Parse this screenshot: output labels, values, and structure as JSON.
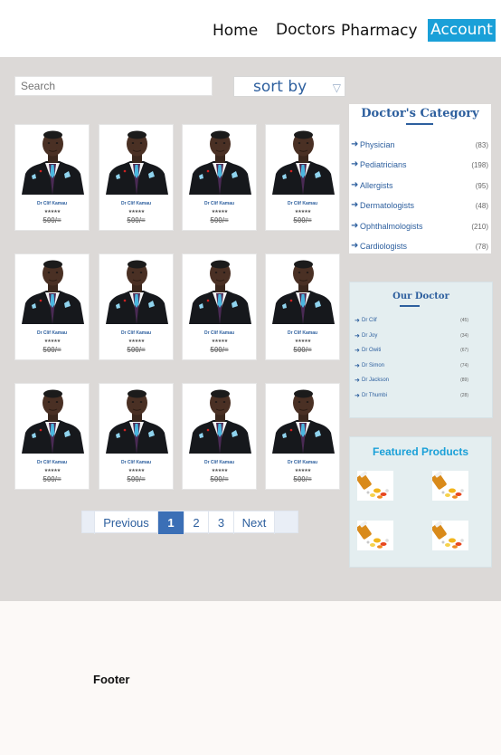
{
  "nav": {
    "home": "Home",
    "doctors": "Doctors",
    "pharmacy": "Pharmacy",
    "account": "Account"
  },
  "toolbar": {
    "search_placeholder": "Search",
    "sort_label": "sort by",
    "sort_icon": "triangle-down-icon"
  },
  "doctor_cards": [
    {
      "name": "Dr Clif Kamau",
      "rating": "★★★★★",
      "price": "500/="
    },
    {
      "name": "Dr Clif Kamau",
      "rating": "★★★★★",
      "price": "500/="
    },
    {
      "name": "Dr Clif Kamau",
      "rating": "★★★★★",
      "price": "500/="
    },
    {
      "name": "Dr Clif Kamau",
      "rating": "★★★★★",
      "price": "500/="
    },
    {
      "name": "Dr Clif Kamau",
      "rating": "★★★★★",
      "price": "500/="
    },
    {
      "name": "Dr Clif Kamau",
      "rating": "★★★★★",
      "price": "500/="
    },
    {
      "name": "Dr Clif Kamau",
      "rating": "★★★★★",
      "price": "500/="
    },
    {
      "name": "Dr Clif Kamau",
      "rating": "★★★★★",
      "price": "500/="
    },
    {
      "name": "Dr Clif Kamau",
      "rating": "★★★★★",
      "price": "500/="
    },
    {
      "name": "Dr Clif Kamau",
      "rating": "★★★★★",
      "price": "500/="
    },
    {
      "name": "Dr Clif Kamau",
      "rating": "★★★★★",
      "price": "500/="
    },
    {
      "name": "Dr Clif Kamau",
      "rating": "★★★★★",
      "price": "500/="
    }
  ],
  "pagination": {
    "previous": "Previous",
    "pages": [
      "1",
      "2",
      "3"
    ],
    "current": "1",
    "next": "Next"
  },
  "doctor_category": {
    "title": "Doctor's Category",
    "items": [
      {
        "label": "Physician",
        "count": "(83)"
      },
      {
        "label": "Pediatricians",
        "count": "(198)"
      },
      {
        "label": "Allergists",
        "count": "(95)"
      },
      {
        "label": "Dermatologists",
        "count": "(48)"
      },
      {
        "label": "Ophthalmologists",
        "count": "(210)"
      },
      {
        "label": "Cardiologists",
        "count": "(78)"
      }
    ]
  },
  "our_doctor": {
    "title": "Our Doctor",
    "items": [
      {
        "label": "Dr Clif",
        "count": "(45)"
      },
      {
        "label": "Dr Joy",
        "count": "(34)"
      },
      {
        "label": "Dr Owiti",
        "count": "(67)"
      },
      {
        "label": "Dr Simon",
        "count": "(74)"
      },
      {
        "label": "Dr Jackson",
        "count": "(89)"
      },
      {
        "label": "Dr Thumbi",
        "count": "(28)"
      }
    ]
  },
  "featured": {
    "title": "Featured Products",
    "product_count": 4,
    "product_icon": "medicine-pills-icon"
  },
  "footer": {
    "label": "Footer"
  },
  "colors": {
    "accent": "#1aa0d8",
    "brand_blue": "#2d5f9e",
    "active_page": "#3b6fb6",
    "content_bg": "#dcd9d7"
  }
}
